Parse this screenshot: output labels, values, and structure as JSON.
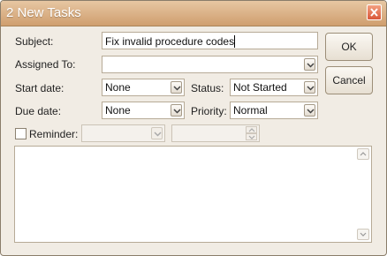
{
  "window": {
    "title": "2 New Tasks"
  },
  "form": {
    "subject_label": "Subject:",
    "subject_value": "Fix invalid procedure codes",
    "assigned_label": "Assigned To:",
    "assigned_value": "",
    "start_label": "Start date:",
    "start_value": "None",
    "status_label": "Status:",
    "status_value": "Not Started",
    "due_label": "Due date:",
    "due_value": "None",
    "priority_label": "Priority:",
    "priority_value": "Normal",
    "reminder_label": "Reminder:",
    "reminder_checked": false,
    "reminder_date_value": "",
    "reminder_time_value": "",
    "notes_value": ""
  },
  "buttons": {
    "ok_label": "OK",
    "cancel_label": "Cancel"
  },
  "icons": {
    "close": "close-icon",
    "dropdown": "chevron-down-icon",
    "spin_up": "chevron-up-icon",
    "spin_down": "chevron-down-icon",
    "scroll_up": "scroll-up-icon",
    "scroll_down": "scroll-down-icon"
  },
  "colors": {
    "titlebar": "#d9ad7f",
    "close_button": "#e06a4b",
    "dialog_bg": "#f1ece4"
  }
}
